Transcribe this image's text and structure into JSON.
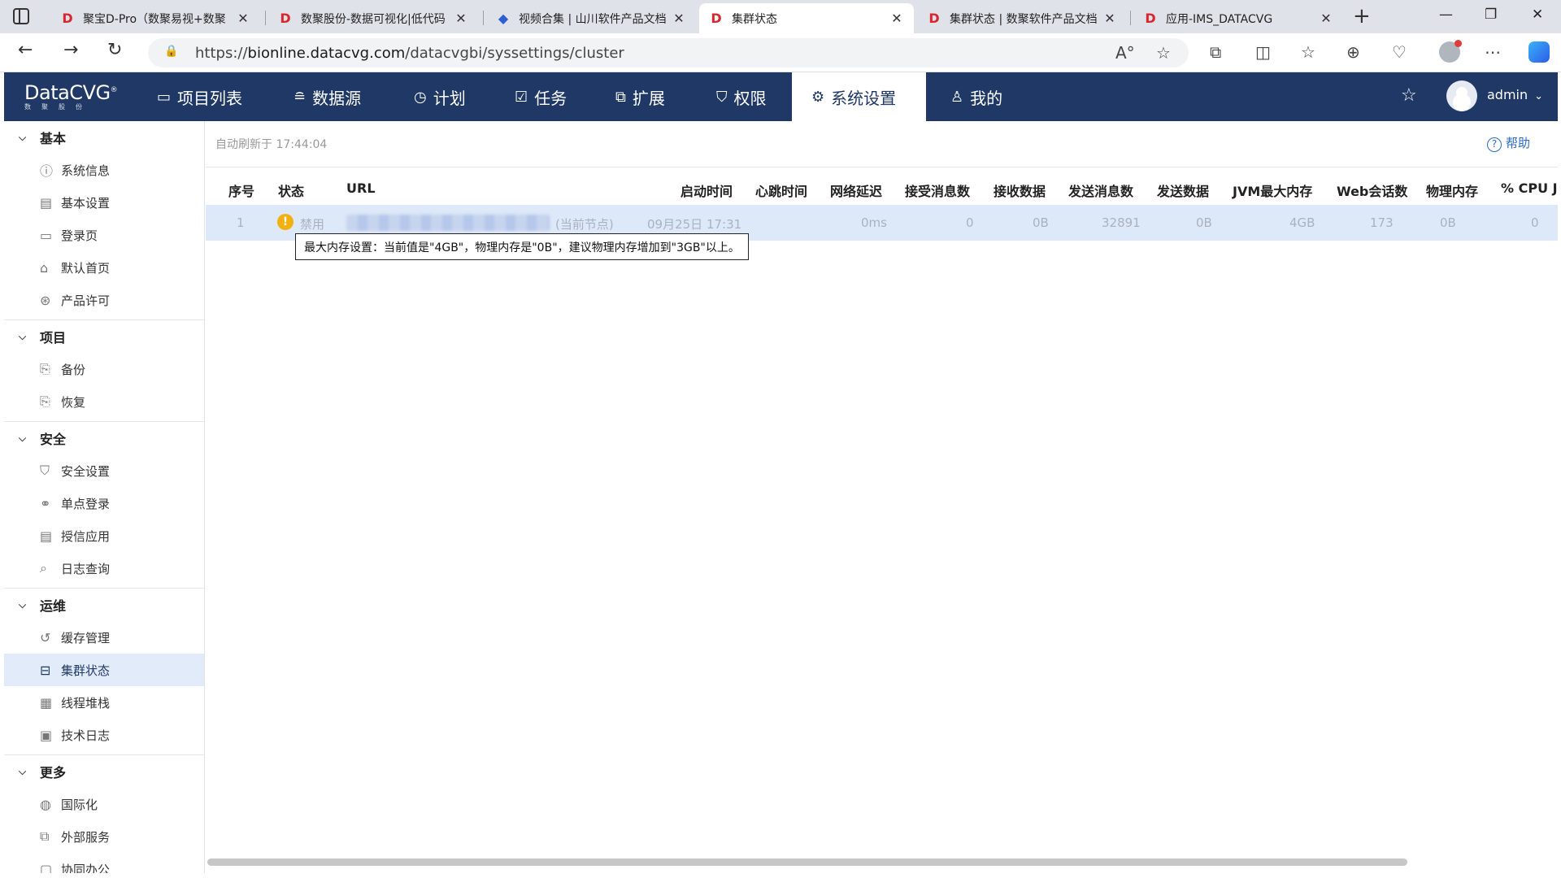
{
  "browser": {
    "tabs": [
      {
        "title": "聚宝D-Pro（数聚易视+数聚",
        "favicon": "D"
      },
      {
        "title": "数聚股份-数据可视化|低代码",
        "favicon": "D"
      },
      {
        "title": "视频合集 | 山川软件产品文档",
        "favicon": "blue-logo"
      },
      {
        "title": "集群状态",
        "favicon": "D"
      },
      {
        "title": "集群状态 | 数聚软件产品文档",
        "favicon": "D"
      },
      {
        "title": "应用-IMS_DATACVG",
        "favicon": "D"
      }
    ],
    "active_tab_index": 3,
    "url_prefix": "https://",
    "url_host": "bionline.datacvg.com",
    "url_path": "/datacvgbi/syssettings/cluster"
  },
  "app": {
    "logo_name": "DataCVG",
    "logo_reg": "®",
    "logo_sub": "数聚股份",
    "nav": [
      {
        "label": "项目列表",
        "icon": "briefcase-icon"
      },
      {
        "label": "数据源",
        "icon": "database-icon"
      },
      {
        "label": "计划",
        "icon": "clock-icon"
      },
      {
        "label": "任务",
        "icon": "task-icon"
      },
      {
        "label": "扩展",
        "icon": "extend-icon"
      },
      {
        "label": "权限",
        "icon": "shield-icon"
      },
      {
        "label": "系统设置",
        "icon": "gear-icon",
        "active": true
      },
      {
        "label": "我的",
        "icon": "user-icon"
      }
    ],
    "user": "admin"
  },
  "sidebar": {
    "groups": [
      {
        "title": "基本",
        "items": [
          "系统信息",
          "基本设置",
          "登录页",
          "默认首页",
          "产品许可"
        ]
      },
      {
        "title": "项目",
        "items": [
          "备份",
          "恢复"
        ]
      },
      {
        "title": "安全",
        "items": [
          "安全设置",
          "单点登录",
          "授信应用",
          "日志查询"
        ]
      },
      {
        "title": "运维",
        "items": [
          "缓存管理",
          "集群状态",
          "线程堆栈",
          "技术日志"
        ]
      },
      {
        "title": "更多",
        "items": [
          "国际化",
          "外部服务",
          "协同办公"
        ]
      }
    ],
    "active_item": "集群状态"
  },
  "main": {
    "refresh_text": "自动刷新于 17:44:04",
    "help_label": "帮助",
    "columns": [
      "序号",
      "状态",
      "URL",
      "启动时间",
      "心跳时间",
      "网络延迟",
      "接受消息数",
      "接收数据",
      "发送消息数",
      "发送数据",
      "JVM最大内存",
      "Web会话数",
      "物理内存",
      "% CPU J"
    ],
    "rows": [
      {
        "index": "1",
        "status": "禁用",
        "url_note": "(当前节点)",
        "start_time": "09月25日 17:31",
        "heartbeat": "",
        "latency": "0ms",
        "recv_msgs": "0",
        "recv_data": "0B",
        "sent_msgs": "32891",
        "sent_data": "0B",
        "jvm_max": "4GB",
        "web_sessions": "173",
        "phys_mem": "0B",
        "cpu": "0"
      }
    ],
    "tooltip": "最大内存设置：当前值是\"4GB\"，物理内存是\"0B\"，建议物理内存增加到\"3GB\"以上。"
  }
}
